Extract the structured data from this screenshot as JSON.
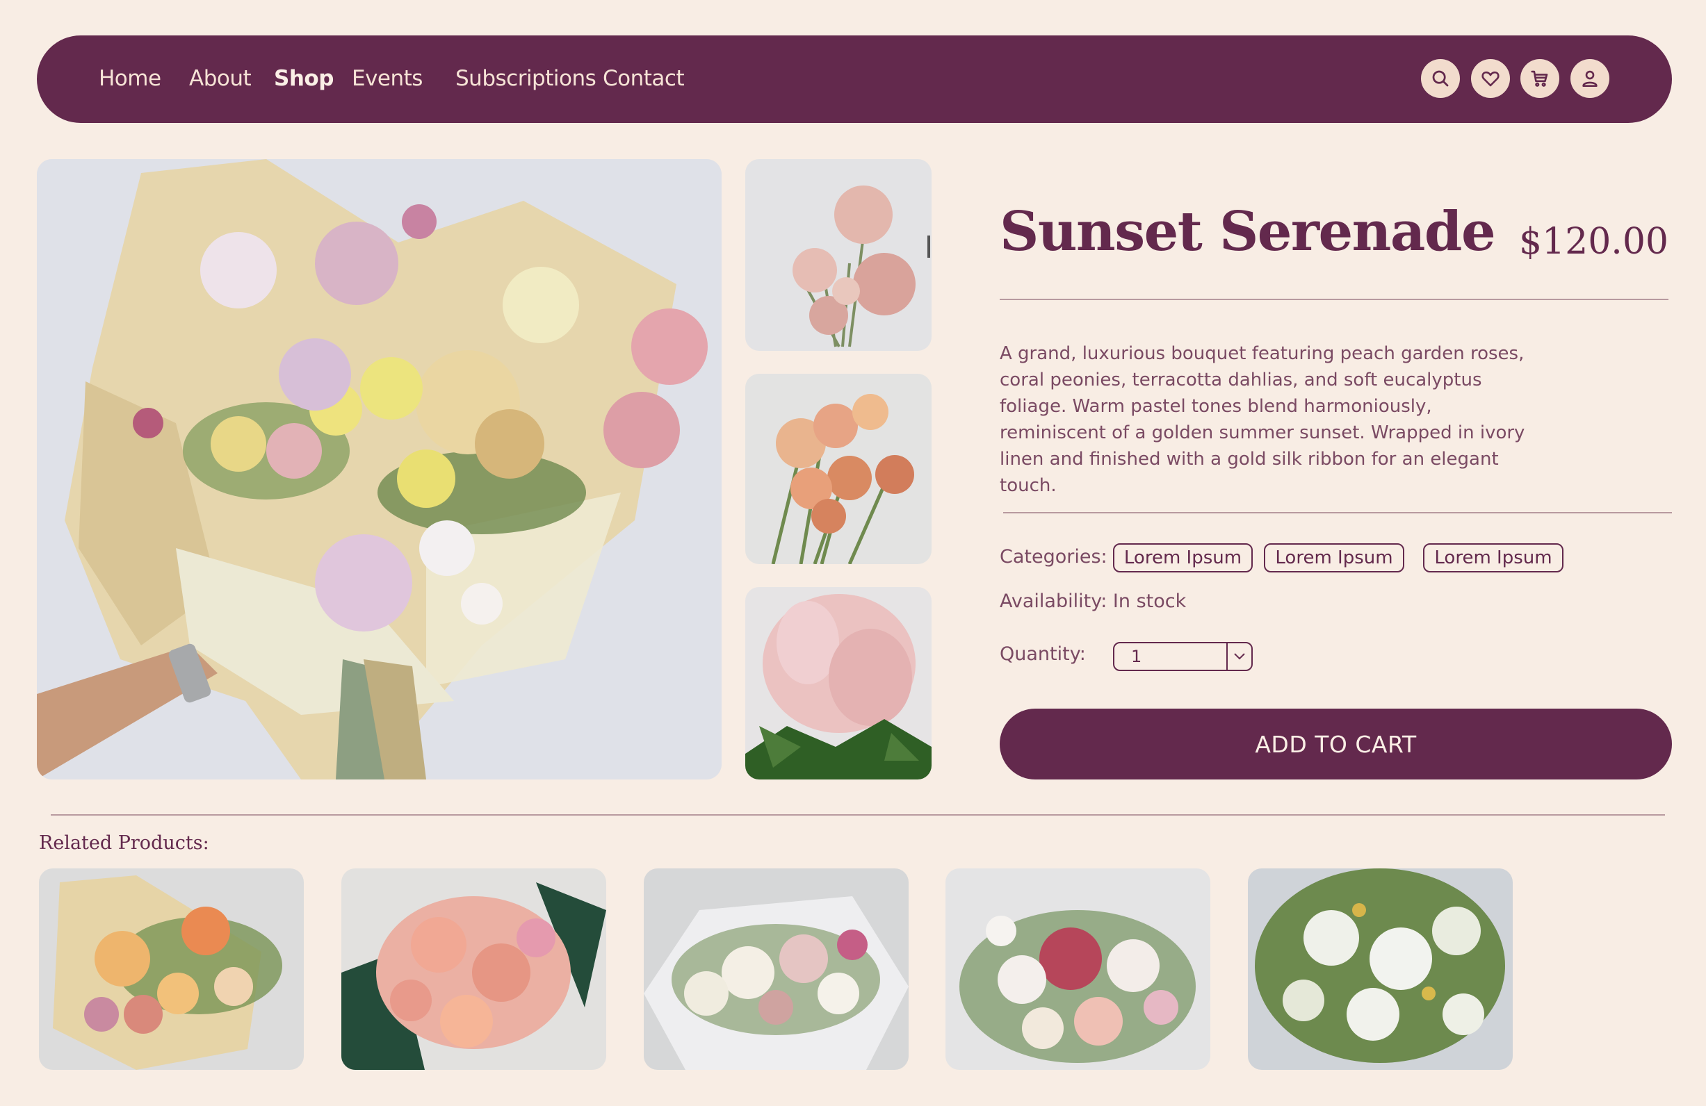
{
  "nav": {
    "links": [
      "Home",
      "About",
      "Shop",
      "Events",
      "Subscriptions",
      "Contact"
    ],
    "active": "Shop",
    "icons": [
      "search-icon",
      "heart-icon",
      "cart-icon",
      "user-icon"
    ]
  },
  "product": {
    "title": "Sunset Serenade",
    "price": "$120.00",
    "description": "A grand, luxurious bouquet featuring peach garden roses, coral peonies, terracotta dahlias, and soft eucalyptus foliage. Warm pastel tones blend harmoniously, reminiscent of a golden summer sunset. Wrapped in ivory linen and finished with a gold silk ribbon for an elegant touch.",
    "categories_label": "Categories:",
    "categories": [
      "Lorem Ipsum",
      "Lorem Ipsum",
      "Lorem Ipsum"
    ],
    "availability_label": "Availability:",
    "availability_value": "In stock",
    "quantity_label": "Quantity:",
    "quantity_value": "1",
    "add_to_cart_label": "ADD TO CART"
  },
  "related": {
    "heading": "Related Products:"
  },
  "colors": {
    "background": "#f8ede4",
    "brand": "#63294d",
    "icon_bg": "#f2dccd"
  }
}
